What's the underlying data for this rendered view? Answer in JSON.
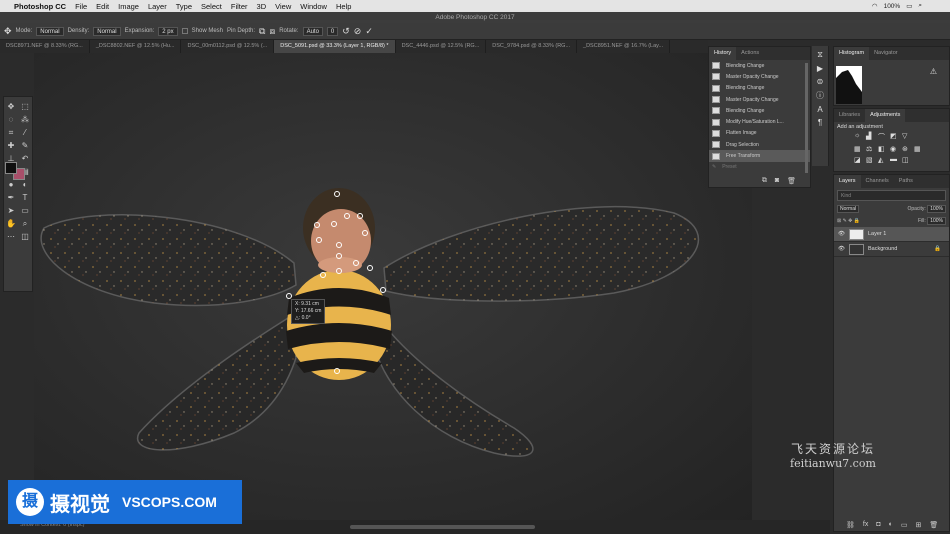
{
  "menubar": {
    "app": "Photoshop CC",
    "items": [
      "File",
      "Edit",
      "Image",
      "Layer",
      "Type",
      "Select",
      "Filter",
      "3D",
      "View",
      "Window",
      "Help"
    ],
    "battery": "100%"
  },
  "window_title": "Adobe Photoshop CC 2017",
  "options": {
    "mode_label": "Mode:",
    "mode_value": "Normal",
    "density_label": "Density:",
    "density_value": "Normal",
    "expansion_label": "Expansion:",
    "expansion_value": "2 px",
    "show_mesh": "Show Mesh",
    "pin_depth": "Pin Depth:",
    "rotate_label": "Rotate:",
    "rotate_value": "Auto",
    "rotate_deg": "0"
  },
  "doc_tabs": [
    {
      "label": "DSC8971.NEF @ 8.33% (RG...",
      "active": false
    },
    {
      "label": "_DSC8802.NEF @ 12.5% (Hu...",
      "active": false
    },
    {
      "label": "DSC_00m0112.psd @ 12.5% (...",
      "active": false
    },
    {
      "label": "DSC_5091.psd @ 33.3% (Layer 1, RGB/8) *",
      "active": true
    },
    {
      "label": "DSC_4446.psd @ 12.5% (RG...",
      "active": false
    },
    {
      "label": "DSC_9784.psd @ 8.33% (RG...",
      "active": false
    },
    {
      "label": "_DSC8951.NEF @ 16.7% (Lay...",
      "active": false
    }
  ],
  "history": {
    "tabs": [
      "History",
      "Actions"
    ],
    "items": [
      {
        "label": "Blending Change",
        "state": "normal"
      },
      {
        "label": "Master Opacity Change",
        "state": "normal"
      },
      {
        "label": "Blending Change",
        "state": "normal"
      },
      {
        "label": "Master Opacity Change",
        "state": "normal"
      },
      {
        "label": "Blending Change",
        "state": "normal"
      },
      {
        "label": "Modify Hue/Saturation L...",
        "state": "normal"
      },
      {
        "label": "Flatten Image",
        "state": "normal"
      },
      {
        "label": "Drag Selection",
        "state": "normal"
      },
      {
        "label": "Free Transform",
        "state": "active"
      },
      {
        "label": "Preset",
        "state": "dim"
      }
    ]
  },
  "histogram": {
    "tabs": [
      "Histogram",
      "Navigator"
    ]
  },
  "adjustments": {
    "tabs": [
      "Libraries",
      "Adjustments"
    ],
    "title": "Add an adjustment"
  },
  "layers": {
    "tabs": [
      "Layers",
      "Channels",
      "Paths"
    ],
    "search": "Kind",
    "blend": "Normal",
    "opacity_label": "Opacity:",
    "opacity_value": "100%",
    "fill_label": "Fill:",
    "fill_value": "100%",
    "items": [
      {
        "name": "Layer 1",
        "active": true
      },
      {
        "name": "Background",
        "active": false
      }
    ]
  },
  "transform_readout": {
    "x": "X: 9.31 cm",
    "y": "Y: 17.66 cm",
    "angle": "△: 0.0°"
  },
  "status_text": "Show in Context: 0 (Inspc)",
  "watermark": {
    "logo_glyph": "摄",
    "logo_cn": "摄视觉",
    "logo_en": "VSCOPS.COM",
    "site_cn": "飞天资源论坛",
    "site_url": "feitianwu7.com"
  },
  "colors": {
    "accent": "#1a6fd8",
    "bg_swatch": "#a84f6a",
    "fur": "#e8b44c"
  }
}
